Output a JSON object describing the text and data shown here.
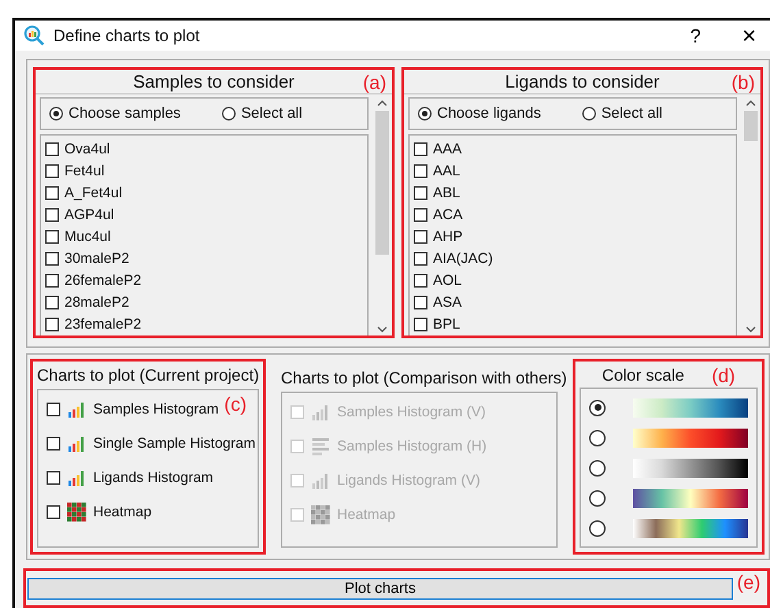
{
  "window": {
    "title": "Define charts to plot",
    "help": "?",
    "close": "×"
  },
  "samples": {
    "title": "Samples to consider",
    "annotation": "(a)",
    "modes": [
      {
        "label": "Choose samples",
        "selected": true
      },
      {
        "label": "Select all",
        "selected": false
      }
    ],
    "items": [
      {
        "label": "Ova4ul",
        "checked": false
      },
      {
        "label": "Fet4ul",
        "checked": false
      },
      {
        "label": "A_Fet4ul",
        "checked": false
      },
      {
        "label": "AGP4ul",
        "checked": false
      },
      {
        "label": "Muc4ul",
        "checked": false
      },
      {
        "label": "30maleP2",
        "checked": false
      },
      {
        "label": "26femaleP2",
        "checked": false
      },
      {
        "label": "28maleP2",
        "checked": false
      },
      {
        "label": "23femaleP2",
        "checked": false
      }
    ]
  },
  "ligands": {
    "title": "Ligands to consider",
    "annotation": "(b)",
    "modes": [
      {
        "label": "Choose ligands",
        "selected": true
      },
      {
        "label": "Select all",
        "selected": false
      }
    ],
    "items": [
      {
        "label": "AAA",
        "checked": false
      },
      {
        "label": "AAL",
        "checked": false
      },
      {
        "label": "ABL",
        "checked": false
      },
      {
        "label": "ACA",
        "checked": false
      },
      {
        "label": "AHP",
        "checked": false
      },
      {
        "label": "AIA(JAC)",
        "checked": false
      },
      {
        "label": "AOL",
        "checked": false
      },
      {
        "label": "ASA",
        "checked": false
      },
      {
        "label": "BPL",
        "checked": false
      }
    ]
  },
  "current_charts": {
    "title": "Charts to plot (Current project)",
    "annotation": "(c)",
    "items": [
      {
        "label": "Samples Histogram",
        "kind": "bars",
        "checked": false,
        "disabled": false
      },
      {
        "label": "Single Sample Histogram",
        "kind": "bars",
        "checked": false,
        "disabled": false
      },
      {
        "label": "Ligands Histogram",
        "kind": "bars",
        "checked": false,
        "disabled": false
      },
      {
        "label": "Heatmap",
        "kind": "heatmap",
        "checked": false,
        "disabled": false
      }
    ]
  },
  "comparison_charts": {
    "title": "Charts to plot (Comparison with others)",
    "items": [
      {
        "label": "Samples Histogram (V)",
        "kind": "bars",
        "checked": false,
        "disabled": true
      },
      {
        "label": "Samples Histogram (H)",
        "kind": "hbars",
        "checked": false,
        "disabled": true
      },
      {
        "label": "Ligands Histogram (V)",
        "kind": "bars",
        "checked": false,
        "disabled": true
      },
      {
        "label": "Heatmap",
        "kind": "heatmap",
        "checked": false,
        "disabled": true
      }
    ]
  },
  "color_scale": {
    "title": "Color scale",
    "annotation": "(d)",
    "scales": [
      {
        "selected": true,
        "kind": "greenblue"
      },
      {
        "selected": false,
        "kind": "yelloworangered"
      },
      {
        "selected": false,
        "kind": "greys"
      },
      {
        "selected": false,
        "kind": "spectral"
      },
      {
        "selected": false,
        "kind": "earth"
      }
    ]
  },
  "plot_button": {
    "label": "Plot charts",
    "annotation": "(e)"
  }
}
